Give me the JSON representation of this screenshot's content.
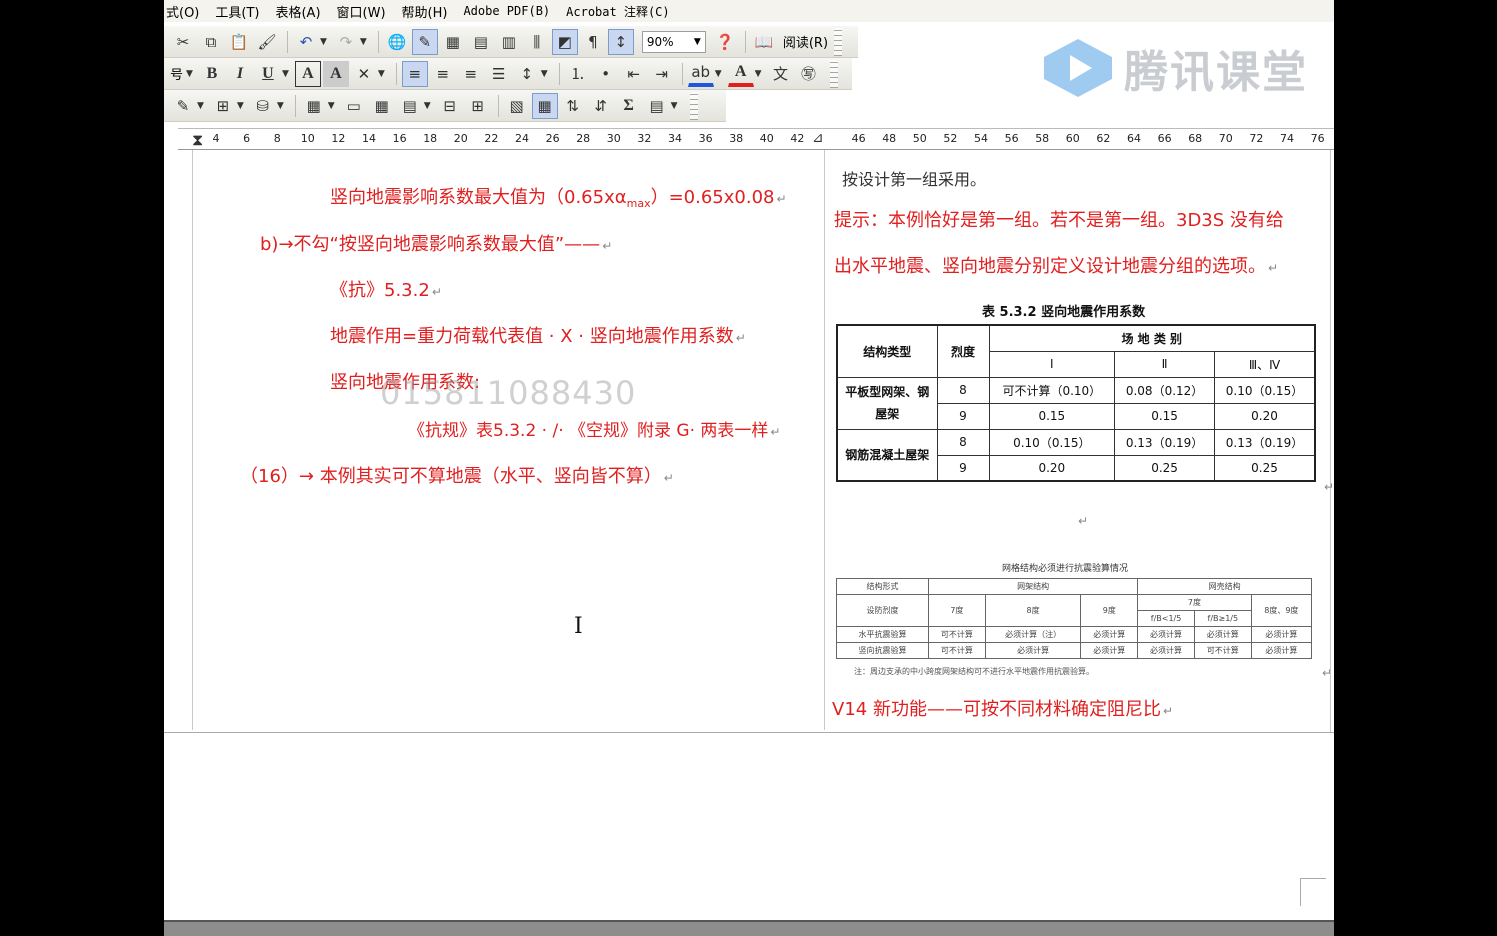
{
  "menu": [
    "式(O)",
    "工具(T)",
    "表格(A)",
    "窗口(W)",
    "帮助(H)",
    "Adobe PDF(B)",
    "Acrobat 注释(C)"
  ],
  "toolbar1": {
    "zoom": "90%",
    "reading_label": "阅读(R)"
  },
  "logo_text": "腾讯课堂",
  "ruler_ticks": [
    "4",
    "6",
    "8",
    "10",
    "12",
    "14",
    "16",
    "18",
    "20",
    "22",
    "24",
    "26",
    "28",
    "30",
    "32",
    "34",
    "36",
    "38",
    "40",
    "42",
    "",
    "46",
    "48",
    "50",
    "52",
    "54",
    "56",
    "58",
    "60",
    "62",
    "64",
    "66",
    "68",
    "70",
    "72",
    "74",
    "76"
  ],
  "left_col": {
    "l1_pre": "竖向地震影响系数最大值为（0.65x",
    "l1_alpha": "α",
    "l1_sub": "max",
    "l1_post": "）=0.65x0.08",
    "l2": "b)→不勾“按竖向地震影响系数最大值”——",
    "l3": "《抗》5.3.2",
    "l4": "地震作用=重力荷载代表值 · X · 竖向地震作用系数",
    "l5": "竖向地震作用系数:",
    "l6": "《抗规》表5.3.2 · /· 《空规》附录 G· 两表一样",
    "l7": "（16）→ 本例其实可不算地震（水平、竖向皆不算）"
  },
  "watermark": "015811088430",
  "right_col": {
    "r1": "按设计第一组采用。",
    "r2": "提示：本例恰好是第一组。若不是第一组。3D3S 没有给",
    "r3": "出水平地震、竖向地震分别定义设计地震分组的选项。",
    "r4": "V14 新功能——可按不同材料确定阻尼比"
  },
  "table_main": {
    "title": "表 5.3.2  竖向地震作用系数",
    "h_struct": "结构类型",
    "h_intensity": "烈度",
    "h_site": "场 地 类 别",
    "h_c1": "Ⅰ",
    "h_c2": "Ⅱ",
    "h_c3": "Ⅲ、Ⅳ",
    "g1": "平板型网架、钢屋架",
    "g2": "钢筋混凝土屋架",
    "rows": [
      [
        "8",
        "可不计算（0.10）",
        "0.08（0.12）",
        "0.10（0.15）"
      ],
      [
        "9",
        "0.15",
        "0.15",
        "0.20"
      ],
      [
        "8",
        "0.10（0.15）",
        "0.13（0.19）",
        "0.13（0.19）"
      ],
      [
        "9",
        "0.20",
        "0.25",
        "0.25"
      ]
    ]
  },
  "table_small": {
    "title": "网格结构必须进行抗震验算情况",
    "h_form": "结构形式",
    "h_grid": "网架结构",
    "h_shell": "网壳结构",
    "h_intensity": "设防烈度",
    "h_7": "7度",
    "h_8": "8度",
    "h_9": "9度",
    "h_f7": "7度",
    "h_fb1": "f/B<1/5",
    "h_fb2": "f/B≥1/5",
    "h_89": "8度、9度",
    "row_h": [
      "水平抗震验算",
      "可不计算",
      "必须计算（注）",
      "必须计算",
      "必须计算",
      "必须计算",
      "必须计算"
    ],
    "row_v": [
      "竖向抗震验算",
      "可不计算",
      "必须计算",
      "必须计算",
      "必须计算",
      "可不计算",
      "必须计算"
    ],
    "note": "注：周边支承的中小跨度网架结构可不进行水平地震作用抗震验算。"
  }
}
